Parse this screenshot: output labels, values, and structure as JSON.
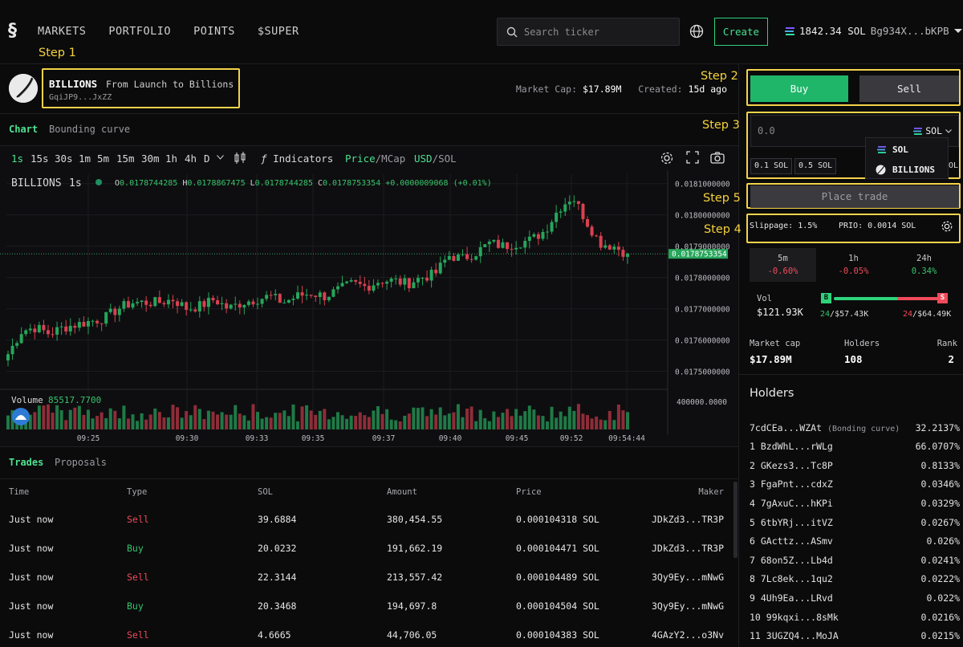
{
  "brand": {
    "logo": "§"
  },
  "nav": {
    "items": [
      "MARKETS",
      "PORTFOLIO",
      "POINTS",
      "$SUPER"
    ]
  },
  "search": {
    "placeholder": "Search ticker",
    "value": ""
  },
  "header_actions": {
    "create_label": "Create",
    "balance": "1842.34 SOL",
    "wallet_address": "Bg934X...bKPB",
    "icons": [
      "globe-icon",
      "chevron-down-icon"
    ]
  },
  "steps": {
    "step1": "Step 1",
    "step2": "Step 2",
    "step3": "Step 3",
    "step4": "Step 4",
    "step5": "Step 5"
  },
  "token": {
    "name": "BILLIONS",
    "tagline": "From Launch to Billions",
    "contract": "GqiJP9...JxZZ",
    "market_cap_label": "Market Cap:",
    "market_cap": "$17.89M",
    "created_label": "Created:",
    "created": "15d ago"
  },
  "view_tabs": {
    "chart": "Chart",
    "bonding": "Bounding curve"
  },
  "chart_toolbar": {
    "timeframes": [
      "1s",
      "15s",
      "30s",
      "1m",
      "5m",
      "15m",
      "30m",
      "1h",
      "4h",
      "D"
    ],
    "active_timeframe": "1s",
    "indicators_label": "Indicators",
    "price_label": "Price",
    "mcap_label": "/MCap",
    "usd_label": "USD",
    "sol_label": "/SOL"
  },
  "chart_data": {
    "type": "candlestick",
    "title": "BILLIONS",
    "interval": "1s",
    "ohlc_legend": {
      "O": "0.0178744285",
      "H": "0.0178867475",
      "L": "0.0178744285",
      "C": "0.0178753354",
      "change": "+0.0000009068",
      "change_pct": "(+0.01%)"
    },
    "x_ticks": [
      "09:25",
      "09:30",
      "09:33",
      "09:35",
      "09:37",
      "09:40",
      "09:45",
      "09:52",
      "09:54:44"
    ],
    "y_ticks": [
      "0.0181000000",
      "0.0180000000",
      "0.0179000000",
      "0.0178000000",
      "0.0177000000",
      "0.0176000000",
      "0.0175000000"
    ],
    "ylim": [
      0.01745,
      0.01813
    ],
    "last_price": "0.0178753354",
    "last_price_value": 0.0178753354,
    "volume_label": "Volume",
    "volume_value": "85517.7700",
    "volume_tick": "400000.0000",
    "price_keypoints": [
      0.017555,
      0.01763,
      0.01764,
      0.01762,
      0.01764,
      0.01765,
      0.01766,
      0.01767,
      0.0177,
      0.01772,
      0.01772,
      0.01772,
      0.01773,
      0.0177,
      0.01771,
      0.01773,
      0.0177,
      0.01772,
      0.01773,
      0.01774,
      0.01772,
      0.01774,
      0.01775,
      0.01774,
      0.01776,
      0.01778,
      0.01777,
      0.01779,
      0.01779,
      0.01778,
      0.0178,
      0.01781,
      0.01787,
      0.01786,
      0.01788,
      0.01791,
      0.0179,
      0.01791,
      0.01792,
      0.01795,
      0.01802,
      0.01806,
      0.01798,
      0.01791,
      0.0179,
      0.017875
    ],
    "up_color": "#26a65b",
    "down_color": "#d94150"
  },
  "trades_tabs": {
    "trades": "Trades",
    "proposals": "Proposals"
  },
  "trades": {
    "headers": [
      "Time",
      "Type",
      "SOL",
      "Amount",
      "Price",
      "Maker"
    ],
    "rows": [
      {
        "time": "Just now",
        "type": "Sell",
        "sol": "39.6884",
        "amount": "380,454.55",
        "price": "0.000104318 SOL",
        "maker": "JDkZd3...TR3P"
      },
      {
        "time": "Just now",
        "type": "Buy",
        "sol": "20.0232",
        "amount": "191,662.19",
        "price": "0.000104471 SOL",
        "maker": "JDkZd3...TR3P"
      },
      {
        "time": "Just now",
        "type": "Sell",
        "sol": "22.3144",
        "amount": "213,557.42",
        "price": "0.000104489 SOL",
        "maker": "3Qy9Ey...mNwG"
      },
      {
        "time": "Just now",
        "type": "Buy",
        "sol": "20.3468",
        "amount": "194,697.8",
        "price": "0.000104504 SOL",
        "maker": "3Qy9Ey...mNwG"
      },
      {
        "time": "Just now",
        "type": "Sell",
        "sol": "4.6665",
        "amount": "44,706.05",
        "price": "0.000104383 SOL",
        "maker": "4GAzY2...o3Nv"
      }
    ]
  },
  "trade_panel": {
    "buy_label": "Buy",
    "sell_label": "Sell",
    "amount_placeholder": "0.0",
    "unit": "SOL",
    "quick_amounts": [
      "0.1 SOL",
      "0.5 SOL"
    ],
    "dropdown_options": [
      "SOL",
      "BILLIONS"
    ],
    "hidden_fragment": "OL",
    "place_label": "Place trade",
    "slippage": "Slippage: 1.5%",
    "prio": "PRIO: 0.0014 SOL"
  },
  "periods": [
    {
      "label": "5m",
      "value": "-0.60%",
      "sign": "neg"
    },
    {
      "label": "1h",
      "value": "-0.05%",
      "sign": "neg"
    },
    {
      "label": "24h",
      "value": "0.34%",
      "sign": "pos"
    }
  ],
  "volume_stats": {
    "label": "Vol",
    "value": "$121.93K",
    "buy_badge": "B",
    "sell_badge": "S",
    "buys_count": "24",
    "buys_value": "/$57.43K",
    "sells_count": "24",
    "sells_value": "/$64.49K",
    "buy_share": 0.56
  },
  "token_stats": {
    "mc_label": "Market cap",
    "mc_value": "$17.89M",
    "holders_label": "Holders",
    "holders_value": "108",
    "rank_label": "Rank",
    "rank_value": "2"
  },
  "holders": {
    "title": "Holders",
    "list": [
      {
        "name": "7cdCEa...WZAt",
        "note": "(Bonding curve)",
        "pct": "32.2137%"
      },
      {
        "name": "1 BzdWhL...rWLg",
        "note": "",
        "pct": "66.0707%"
      },
      {
        "name": "2 GKezs3...Tc8P",
        "note": "",
        "pct": "0.8133%"
      },
      {
        "name": "3 FgaPnt...cdxZ",
        "note": "",
        "pct": "0.0346%"
      },
      {
        "name": "4 7gAxuC...hKPi",
        "note": "",
        "pct": "0.0329%"
      },
      {
        "name": "5 6tbYRj...itVZ",
        "note": "",
        "pct": "0.0267%"
      },
      {
        "name": "6 GActtz...ASmv",
        "note": "",
        "pct": "0.026%"
      },
      {
        "name": "7 68on5Z...Lb4d",
        "note": "",
        "pct": "0.0241%"
      },
      {
        "name": "8 7Lc8ek...1qu2",
        "note": "",
        "pct": "0.0222%"
      },
      {
        "name": "9 4Uh9Ea...LRvd",
        "note": "",
        "pct": "0.022%"
      },
      {
        "name": "10 99kqxi...8sMk",
        "note": "",
        "pct": "0.0216%"
      },
      {
        "name": "11 3UGZQ4...MoJA",
        "note": "",
        "pct": "0.0215%"
      }
    ]
  }
}
